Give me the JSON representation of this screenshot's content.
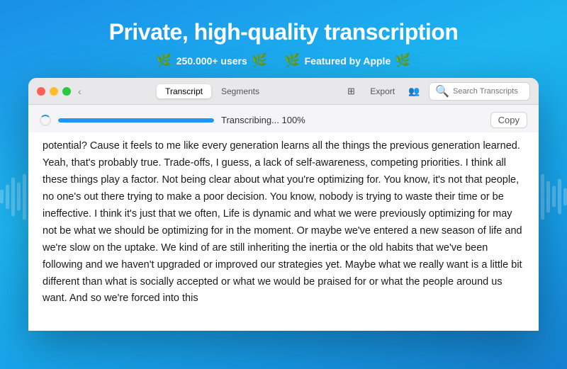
{
  "header": {
    "title": "Private, high-quality transcription",
    "badge1": {
      "laurel_left": "❧",
      "laurel_right": "❧",
      "text": "250.000+ users"
    },
    "badge2": {
      "laurel_left": "❧",
      "laurel_right": "❧",
      "text": "Featured by Apple"
    }
  },
  "app": {
    "tabs": [
      {
        "label": "Transcript",
        "active": true
      },
      {
        "label": "Segments",
        "active": false
      }
    ],
    "toolbar": {
      "export_label": "Export",
      "search_placeholder": "Search Transcripts"
    },
    "progress": {
      "label": "Transcribing... 100%",
      "percent": 100,
      "copy_label": "Copy"
    },
    "transcript": {
      "text": "potential? Cause it feels to me like every generation learns all the things the previous generation learned. Yeah, that's probably true. Trade-offs, I guess, a lack of self-awareness, competing priorities. I think all these things play a factor. Not being clear about what you're optimizing for. You know, it's not that people, no one's out there trying to make a poor decision. You know, nobody is trying to waste their time or be ineffective. I think it's just that we often, Life is dynamic and what we were previously optimizing for may not be what we should be optimizing for in the moment. Or maybe we've entered a new season of life and we're slow on the uptake. We kind of are still inheriting the inertia or the old habits that we've been following and we haven't upgraded or improved our strategies yet. Maybe what we really want is a little bit different than what is socially accepted or what we would be praised for or what the people around us want. And so we're forced into this"
    }
  },
  "waveform": {
    "left_heights": [
      20,
      35,
      55,
      40,
      65,
      80,
      55,
      70,
      45,
      60,
      85,
      60,
      75,
      50,
      40,
      30,
      55,
      70,
      85,
      65,
      45
    ],
    "right_heights": [
      45,
      65,
      80,
      55,
      70,
      45,
      60,
      85,
      60,
      75,
      50,
      40,
      30,
      55,
      70,
      85,
      65,
      45,
      30,
      50,
      25
    ]
  }
}
